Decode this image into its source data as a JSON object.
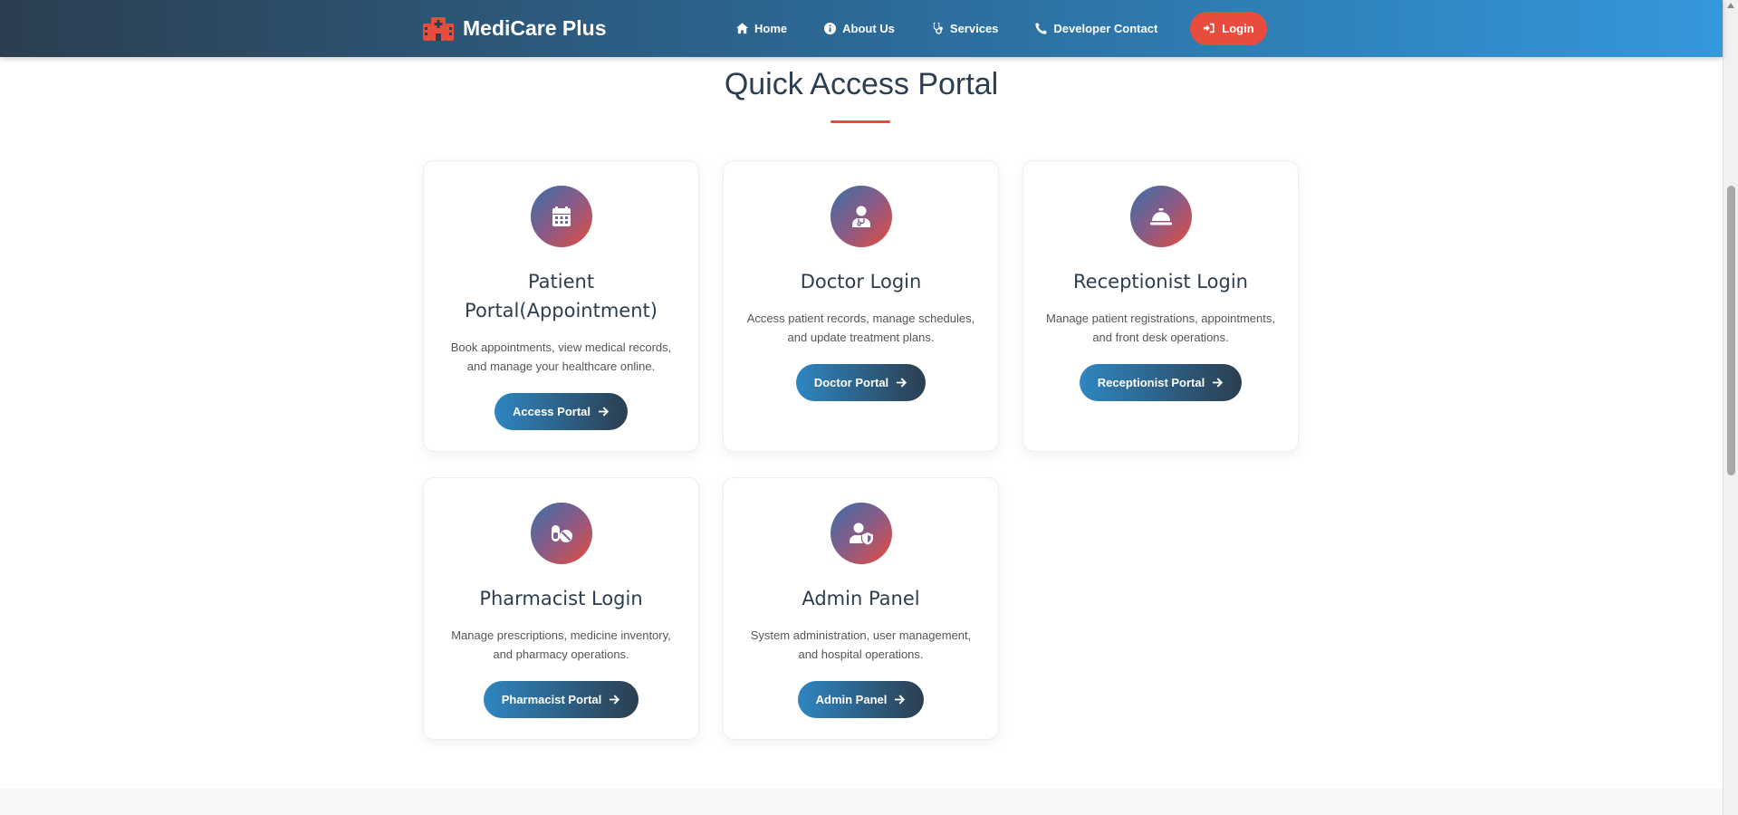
{
  "brand": {
    "name": "MediCare Plus",
    "icon": "hospital-icon"
  },
  "nav": {
    "items": [
      {
        "label": "Home",
        "icon": "home-icon"
      },
      {
        "label": "About Us",
        "icon": "info-icon"
      },
      {
        "label": "Services",
        "icon": "stethoscope-icon"
      },
      {
        "label": "Developer Contact",
        "icon": "phone-icon"
      }
    ],
    "login_label": "Login"
  },
  "section": {
    "title": "Quick Access Portal"
  },
  "cards": [
    {
      "title": "Patient Portal(Appointment)",
      "description": "Book appointments, view medical records, and manage your healthcare online.",
      "button": "Access Portal",
      "icon": "calendar-icon"
    },
    {
      "title": "Doctor Login",
      "description": "Access patient records, manage schedules, and update treatment plans.",
      "button": "Doctor Portal",
      "icon": "doctor-icon"
    },
    {
      "title": "Receptionist Login",
      "description": "Manage patient registrations, appointments, and front desk operations.",
      "button": "Receptionist Portal",
      "icon": "concierge-bell-icon"
    },
    {
      "title": "Pharmacist Login",
      "description": "Manage prescriptions, medicine inventory, and pharmacy operations.",
      "button": "Pharmacist Portal",
      "icon": "pills-icon"
    },
    {
      "title": "Admin Panel",
      "description": "System administration, user management, and hospital operations.",
      "button": "Admin Panel",
      "icon": "user-shield-icon"
    }
  ],
  "colors": {
    "nav_gradient_start": "#2c3e50",
    "nav_gradient_end": "#3498db",
    "accent": "#e74c3c",
    "button_gradient_start": "#2e86c1",
    "button_gradient_end": "#2c3e50",
    "text": "#2c3e50"
  }
}
